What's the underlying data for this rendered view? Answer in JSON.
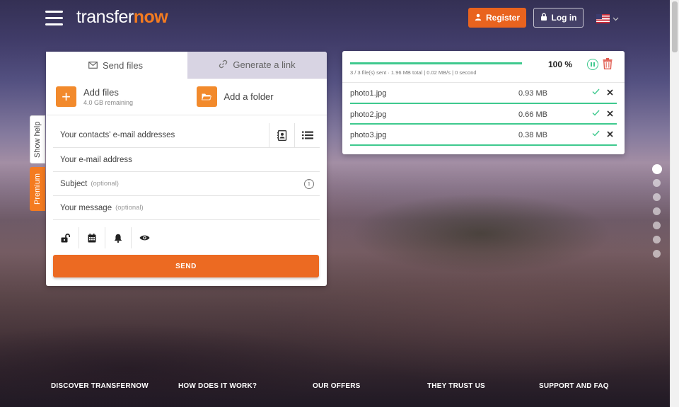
{
  "header": {
    "logo_main": "transfer",
    "logo_accent": "now",
    "register_label": "Register",
    "login_label": "Log in",
    "language": "US flag"
  },
  "side_tabs": {
    "help_label": "Show help",
    "premium_label": "Premium"
  },
  "send_panel": {
    "tab_send": "Send files",
    "tab_link": "Generate a link",
    "add_files_label": "Add files",
    "add_files_sub": "4.0 GB remaining",
    "add_folder_label": "Add a folder",
    "contacts_placeholder": "Your contacts' e-mail addresses",
    "email_placeholder": "Your e-mail address",
    "subject_placeholder": "Subject",
    "subject_optional": "(optional)",
    "message_placeholder": "Your message",
    "message_optional": "(optional)",
    "send_label": "SEND"
  },
  "progress_panel": {
    "progress_fraction": 1.0,
    "stats": "3 / 3 file(s) sent · 1.96 MB total | 0.02 MB/s | 0 second",
    "percent": "100 %",
    "files": [
      {
        "name": "photo1.jpg",
        "size": "0.93 MB",
        "progress": 1.0
      },
      {
        "name": "photo2.jpg",
        "size": "0.66 MB",
        "progress": 1.0
      },
      {
        "name": "photo3.jpg",
        "size": "0.38 MB",
        "progress": 1.0
      }
    ]
  },
  "slider": {
    "count": 7,
    "active_index": 0
  },
  "footer": {
    "discover": "DISCOVER TRANSFERNOW",
    "how": "HOW DOES IT WORK?",
    "offers": "OUR OFFERS",
    "trust": "THEY TRUST US",
    "support": "SUPPORT AND FAQ"
  },
  "colors": {
    "accent": "#f47b20",
    "success": "#3ec98e",
    "danger": "#e05a4f"
  }
}
